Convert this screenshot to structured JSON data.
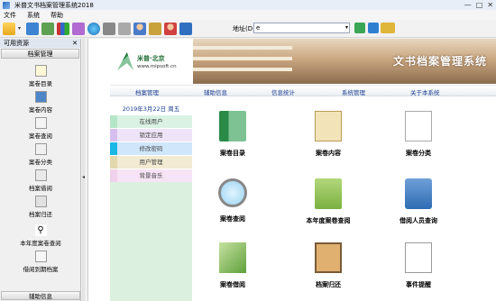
{
  "window": {
    "title": "米普文书档案管理系统2018",
    "controls": [
      "—",
      "□",
      "✕"
    ]
  },
  "menubar": {
    "items": [
      "文件",
      "系统",
      "帮助"
    ]
  },
  "toolbar": {
    "icons": [
      "open-folder-icon",
      "dropdown-icon",
      "grid-icon",
      "list-icon",
      "chart-icon",
      "cube-icon",
      "globe-icon",
      "print-icon",
      "scan-icon",
      "user-icon",
      "key-icon",
      "person-icon",
      "exit-icon"
    ],
    "address_label": "地址(D)",
    "address_value": "e",
    "right_icons": [
      "go-icon",
      "refresh-icon",
      "favorites-icon"
    ]
  },
  "sidebar": {
    "header": "可用资源",
    "close": "✕",
    "section": "档案管理",
    "items": [
      {
        "label": "案卷目录",
        "icon": "catalog-icon"
      },
      {
        "label": "案卷内容",
        "icon": "content-icon"
      },
      {
        "label": "案卷查阅",
        "icon": "lookup-icon"
      },
      {
        "label": "案卷分类",
        "icon": "category-icon"
      },
      {
        "label": "档案借阅",
        "icon": "borrow-icon"
      },
      {
        "label": "档案归还",
        "icon": "return-icon"
      },
      {
        "label": "本年度案卷查阅",
        "icon": "year-lookup-icon"
      },
      {
        "label": "借阅到期档案",
        "icon": "due-icon"
      }
    ],
    "bottom": "辅助信息"
  },
  "banner": {
    "logo_name": "米普·北京",
    "logo_url": "www.mipsoft.cn",
    "title": "文书档案管理系统"
  },
  "navbar": {
    "items": [
      "档案管理",
      "辅助信息",
      "信息统计",
      "系统管理",
      "关于本系统"
    ]
  },
  "left_panel": {
    "date": "2019年3月22日  周五",
    "items": [
      {
        "label": "在线用户",
        "color": "#d9f2e3",
        "strip": "#b6e6c8"
      },
      {
        "label": "锁定应用",
        "color": "#efe3f7",
        "strip": "#d6bfee"
      },
      {
        "label": "修改密码",
        "color": "#cfe6fb",
        "strip": "#19b7e6"
      },
      {
        "label": "用户管理",
        "color": "#f2ead2",
        "strip": "#e3d7ac"
      },
      {
        "label": "背景音乐",
        "color": "#f6e3f5",
        "strip": "#f0d1ec"
      }
    ]
  },
  "tiles": [
    {
      "label": "案卷目录",
      "icon": "book-icon",
      "kind": "book"
    },
    {
      "label": "案卷内容",
      "icon": "notes-icon",
      "kind": "notes"
    },
    {
      "label": "案卷分类",
      "icon": "checklist-icon",
      "kind": "check"
    },
    {
      "label": "案卷查阅",
      "icon": "magnifier-icon",
      "kind": "mag"
    },
    {
      "label": "本年度案卷查阅",
      "icon": "folder-search-icon",
      "kind": "folder"
    },
    {
      "label": "借阅人员查询",
      "icon": "people-icon",
      "kind": "people"
    },
    {
      "label": "案卷借阅",
      "icon": "stack-icon",
      "kind": "stack"
    },
    {
      "label": "档案归还",
      "icon": "clipboard-icon",
      "kind": "clip"
    },
    {
      "label": "事件提醒",
      "icon": "calendar-icon",
      "kind": "cal"
    }
  ]
}
